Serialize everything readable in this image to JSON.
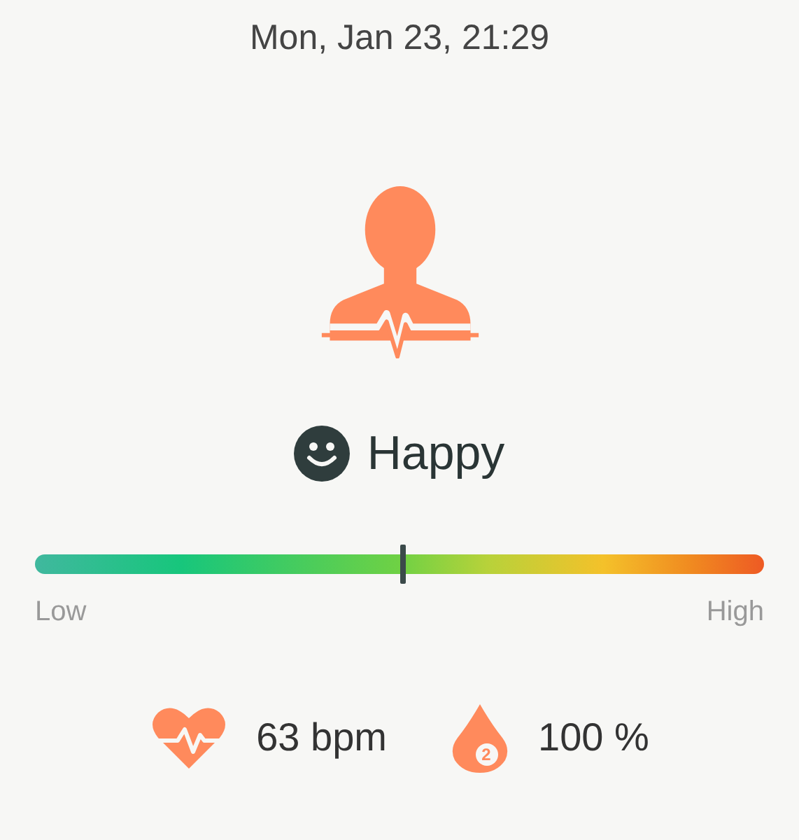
{
  "timestamp": "Mon, Jan 23, 21:29",
  "mood": {
    "label": "Happy"
  },
  "meter": {
    "level": 0.505,
    "low_label": "Low",
    "high_label": "High"
  },
  "stats": [
    {
      "kind": "heart",
      "value": "63 bpm"
    },
    {
      "kind": "drop",
      "value": "100 %",
      "badge": "2"
    }
  ]
}
